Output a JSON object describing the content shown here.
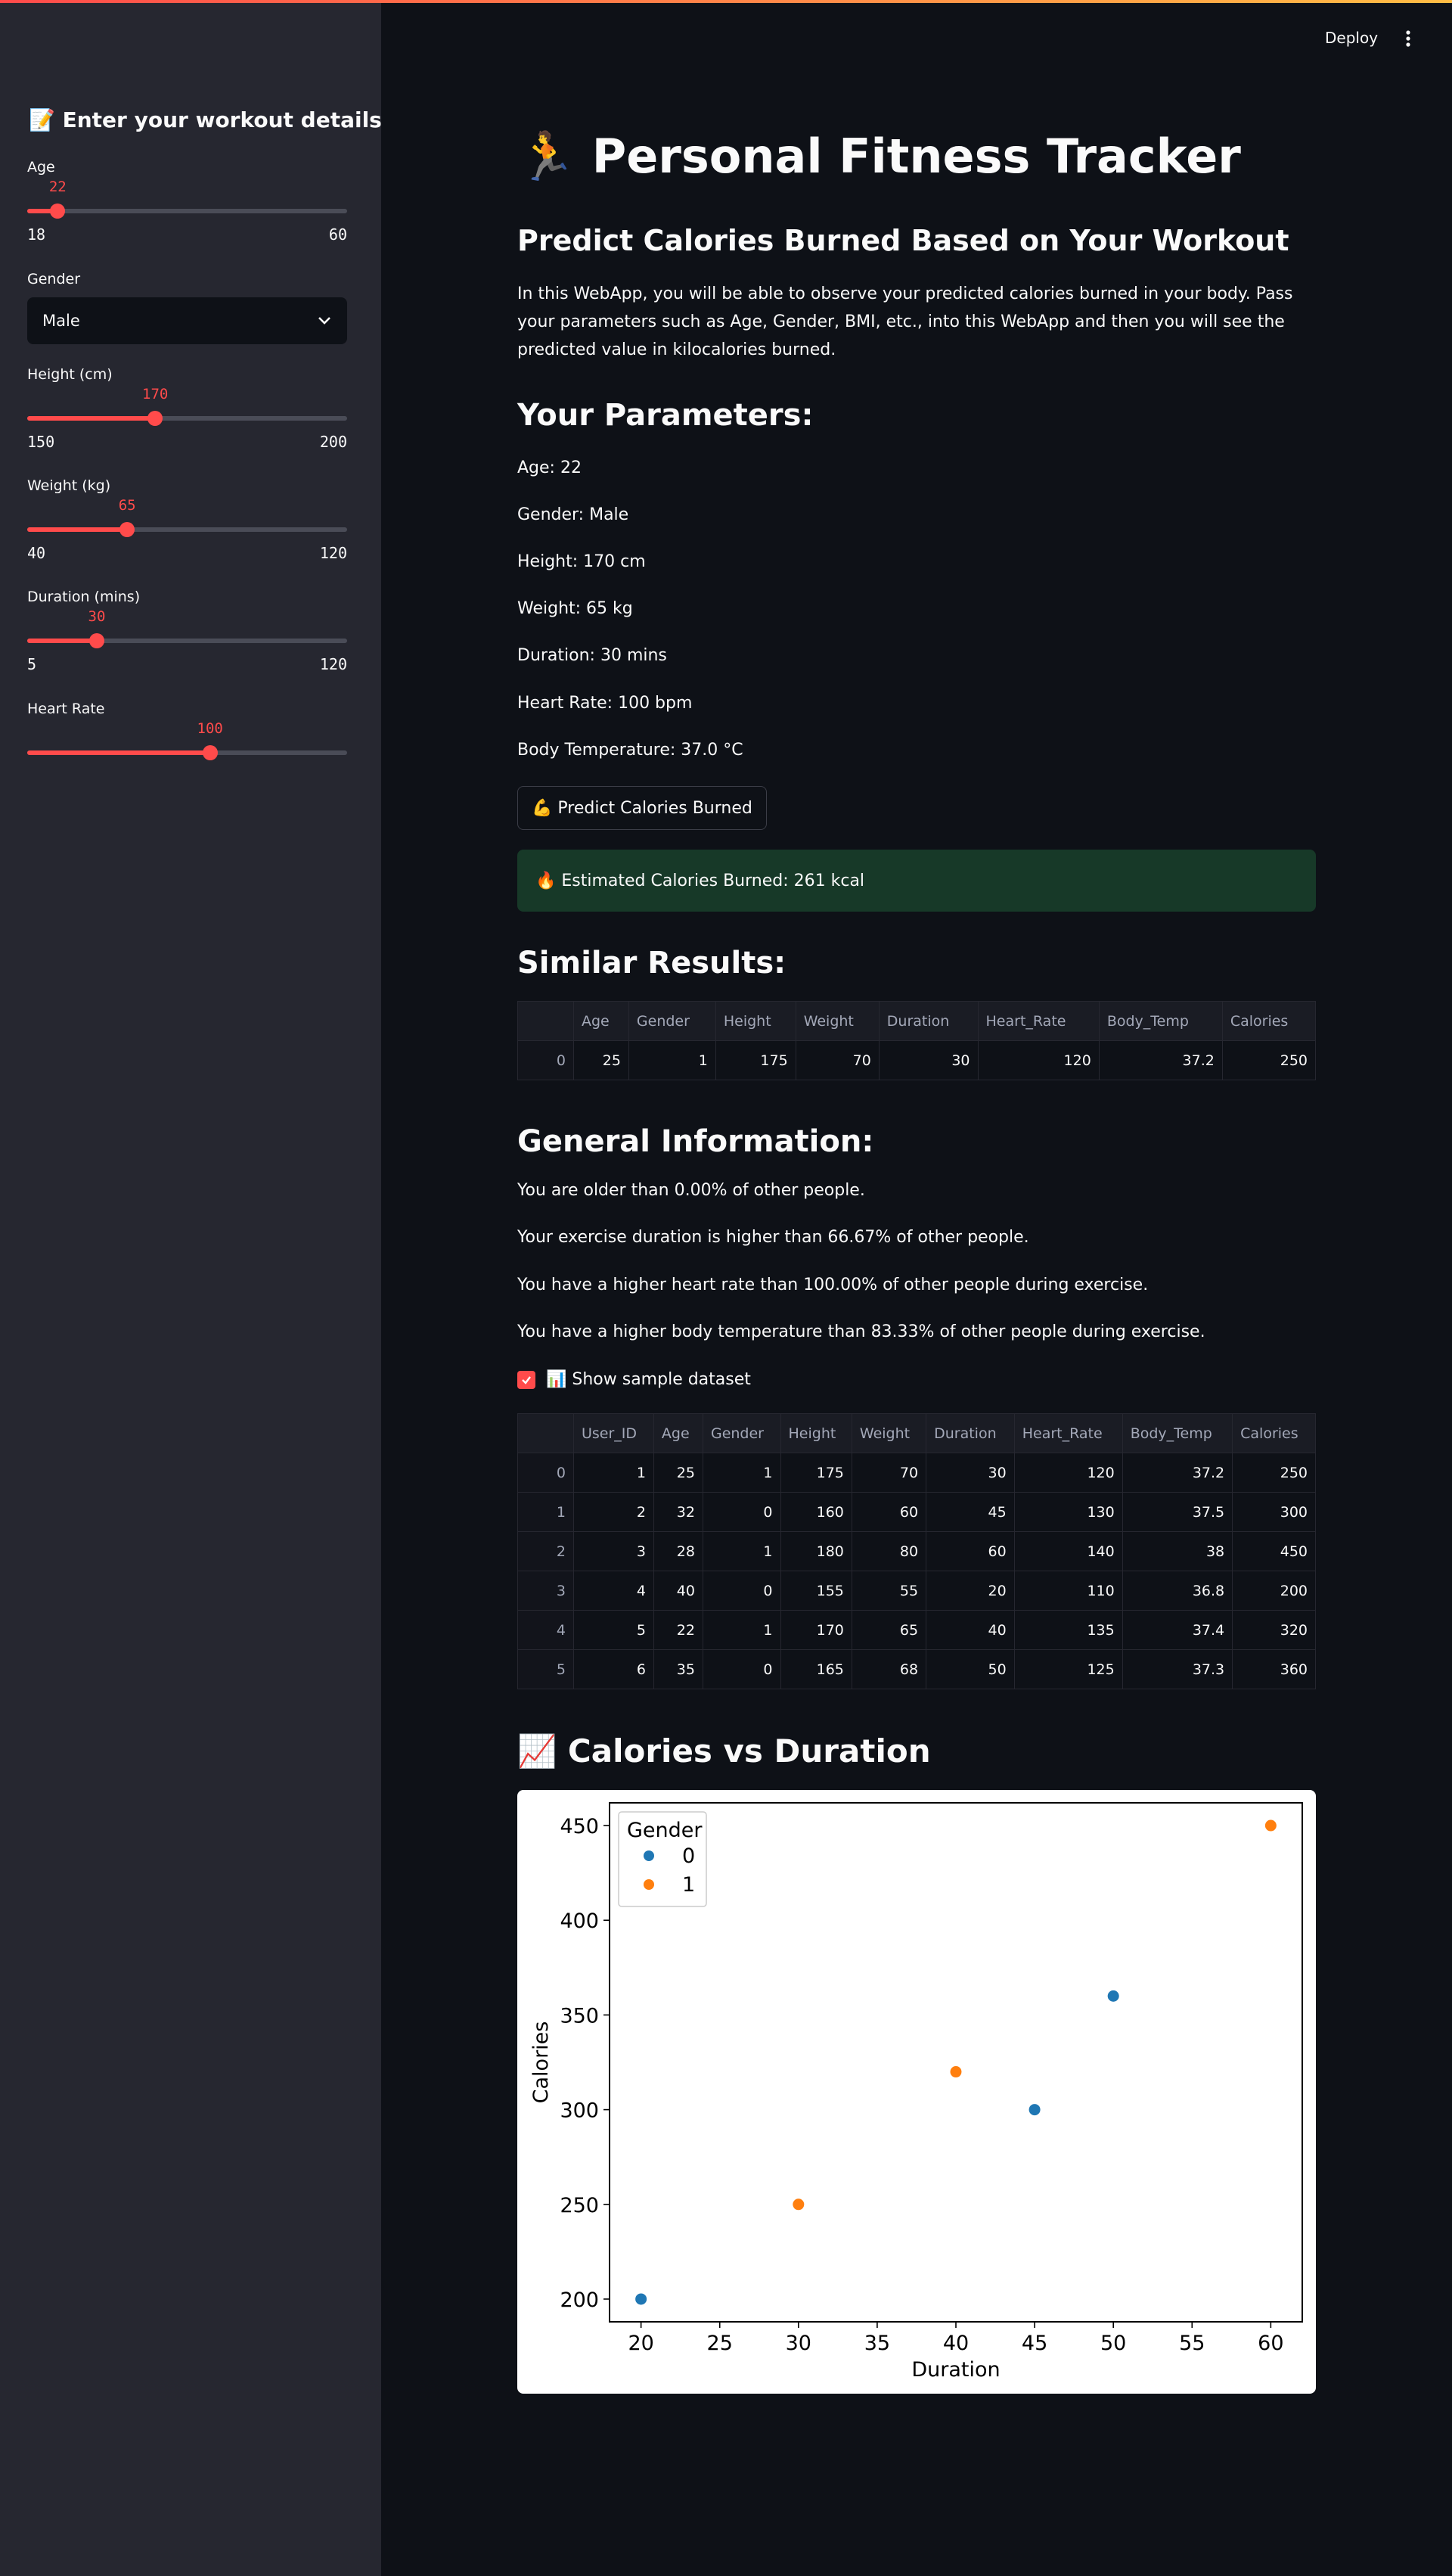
{
  "sidebar": {
    "header": "📝 Enter your workout details",
    "age": {
      "label": "Age",
      "value": 22,
      "min": 18,
      "max": 60
    },
    "gender": {
      "label": "Gender",
      "value": "Male"
    },
    "height": {
      "label": "Height (cm)",
      "value": 170,
      "min": 150,
      "max": 200
    },
    "weight": {
      "label": "Weight (kg)",
      "value": 65,
      "min": 40,
      "max": 120
    },
    "duration": {
      "label": "Duration (mins)",
      "value": 30,
      "min": 5,
      "max": 120
    },
    "heart_rate": {
      "label": "Heart Rate",
      "value": 100,
      "min": 60,
      "max": 130
    }
  },
  "toolbar": {
    "deploy_label": "Deploy"
  },
  "main": {
    "title": "🏃 Personal Fitness Tracker",
    "subtitle": "Predict Calories Burned Based on Your Workout",
    "description": "In this WebApp, you will be able to observe your predicted calories burned in your body. Pass your parameters such as Age, Gender, BMI, etc., into this WebApp and then you will see the predicted value in kilocalories burned.",
    "params_heading": "Your Parameters:",
    "params": [
      "Age: 22",
      "Gender: Male",
      "Height: 170 cm",
      "Weight: 65 kg",
      "Duration: 30 mins",
      "Heart Rate: 100 bpm",
      "Body Temperature: 37.0 °C"
    ],
    "predict_button": "💪 Predict Calories Burned",
    "result": "🔥 Estimated Calories Burned: 261 kcal",
    "similar_heading": "Similar Results:",
    "similar_table": {
      "columns": [
        "",
        "Age",
        "Gender",
        "Height",
        "Weight",
        "Duration",
        "Heart_Rate",
        "Body_Temp",
        "Calories"
      ],
      "rows": [
        [
          "0",
          "25",
          "1",
          "175",
          "70",
          "30",
          "120",
          "37.2",
          "250"
        ]
      ]
    },
    "general_heading": "General Information:",
    "general_info": [
      "You are older than 0.00% of other people.",
      "Your exercise duration is higher than 66.67% of other people.",
      "You have a higher heart rate than 100.00% of other people during exercise.",
      "You have a higher body temperature than 83.33% of other people during exercise."
    ],
    "show_dataset_label": "📊 Show sample dataset",
    "dataset_table": {
      "columns": [
        "",
        "User_ID",
        "Age",
        "Gender",
        "Height",
        "Weight",
        "Duration",
        "Heart_Rate",
        "Body_Temp",
        "Calories"
      ],
      "rows": [
        [
          "0",
          "1",
          "25",
          "1",
          "175",
          "70",
          "30",
          "120",
          "37.2",
          "250"
        ],
        [
          "1",
          "2",
          "32",
          "0",
          "160",
          "60",
          "45",
          "130",
          "37.5",
          "300"
        ],
        [
          "2",
          "3",
          "28",
          "1",
          "180",
          "80",
          "60",
          "140",
          "38",
          "450"
        ],
        [
          "3",
          "4",
          "40",
          "0",
          "155",
          "55",
          "20",
          "110",
          "36.8",
          "200"
        ],
        [
          "4",
          "5",
          "22",
          "1",
          "170",
          "65",
          "40",
          "135",
          "37.4",
          "320"
        ],
        [
          "5",
          "6",
          "35",
          "0",
          "165",
          "68",
          "50",
          "125",
          "37.3",
          "360"
        ]
      ]
    },
    "chart_heading": "📈 Calories vs Duration"
  },
  "chart_data": {
    "type": "scatter",
    "title": "",
    "xlabel": "Duration",
    "ylabel": "Calories",
    "xlim": [
      18,
      62
    ],
    "ylim": [
      188,
      462
    ],
    "xticks": [
      20,
      25,
      30,
      35,
      40,
      45,
      50,
      55,
      60
    ],
    "yticks": [
      200,
      250,
      300,
      350,
      400,
      450
    ],
    "legend_title": "Gender",
    "legend_position": "top-left",
    "grid": false,
    "series": [
      {
        "name": "0",
        "color": "#1f77b4",
        "points": [
          [
            20,
            200
          ],
          [
            45,
            300
          ],
          [
            50,
            360
          ]
        ]
      },
      {
        "name": "1",
        "color": "#ff7f0e",
        "points": [
          [
            30,
            250
          ],
          [
            40,
            320
          ],
          [
            60,
            450
          ]
        ]
      }
    ]
  }
}
